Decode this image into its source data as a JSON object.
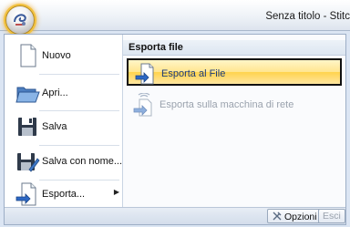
{
  "window": {
    "title": "Senza titolo - Stitc"
  },
  "menu": {
    "items": [
      {
        "label": "Nuovo",
        "icon": "new-document-icon"
      },
      {
        "label": "Apri...",
        "icon": "open-folder-icon"
      },
      {
        "label": "Salva",
        "icon": "save-disk-icon"
      },
      {
        "label": "Salva con nome...",
        "icon": "save-as-icon"
      },
      {
        "label": "Esporta...",
        "icon": "export-icon",
        "submenu": true
      }
    ]
  },
  "submenu": {
    "header": "Esporta file",
    "items": [
      {
        "label": "Esporta al File",
        "icon": "export-to-file-icon",
        "highlighted": true
      },
      {
        "label": "Esporta sulla macchina di rete",
        "icon": "export-network-machine-icon",
        "disabled": true
      }
    ]
  },
  "footer": {
    "options_label": "Opzioni",
    "exit_label": "Esci"
  },
  "colors": {
    "highlight_fill": "#ffe58f",
    "highlight_border": "#111111",
    "orb_glow": "#f3c23d"
  }
}
